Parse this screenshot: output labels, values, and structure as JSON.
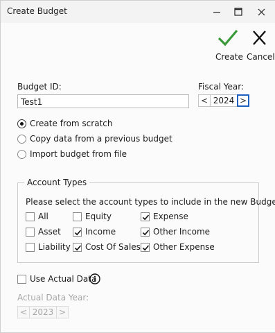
{
  "window": {
    "title": "Create Budget"
  },
  "toolbar": {
    "create_label": "Create",
    "cancel_label": "Cancel"
  },
  "budget_id": {
    "label": "Budget ID:",
    "value": "Test1"
  },
  "fiscal_year": {
    "label": "Fiscal Year:",
    "value": "2024",
    "prev": "<",
    "next": ">"
  },
  "source_options": [
    {
      "label": "Create from scratch",
      "selected": true
    },
    {
      "label": "Copy data from a previous budget",
      "selected": false
    },
    {
      "label": "Import budget from file",
      "selected": false
    }
  ],
  "account_types": {
    "legend": "Account Types",
    "instruction": "Please select the account types to include in the new Budget.",
    "items": [
      {
        "label": "All",
        "checked": false
      },
      {
        "label": "Equity",
        "checked": false
      },
      {
        "label": "Expense",
        "checked": true
      },
      {
        "label": "Asset",
        "checked": false
      },
      {
        "label": "Income",
        "checked": true
      },
      {
        "label": "Other Income",
        "checked": true
      },
      {
        "label": "Liability",
        "checked": false
      },
      {
        "label": "Cost Of Sales",
        "checked": true
      },
      {
        "label": "Other Expense",
        "checked": true
      }
    ]
  },
  "actual_data": {
    "label": "Use Actual Data",
    "checked": false,
    "info_icon": "info-icon"
  },
  "actual_data_year": {
    "label": "Actual Data Year:",
    "value": "2023",
    "prev": "<",
    "next": ">"
  },
  "colors": {
    "accent_green": "#3a9a3a",
    "focus_blue": "#1f5fbf"
  }
}
